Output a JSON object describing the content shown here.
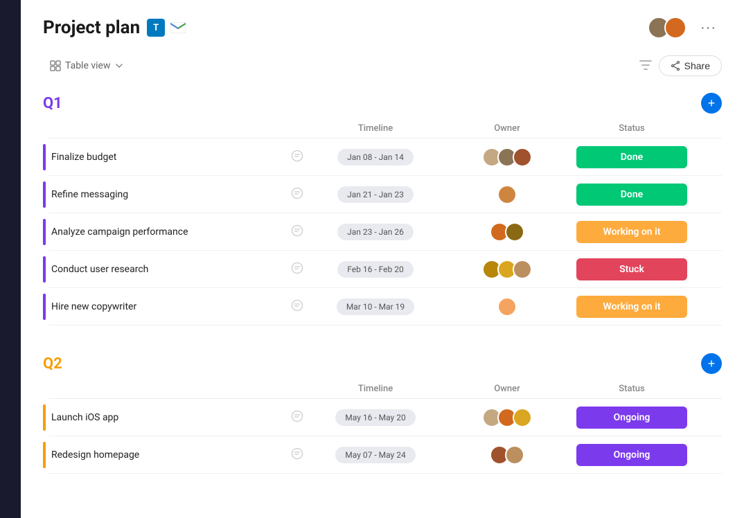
{
  "page": {
    "title": "Project plan"
  },
  "header": {
    "title": "Project plan",
    "trello_icon": "T",
    "gmail_icon": "M",
    "more_label": "···",
    "share_label": "Share",
    "view_label": "Table view"
  },
  "q1": {
    "title": "Q1",
    "timeline_col": "Timeline",
    "owner_col": "Owner",
    "status_col": "Status",
    "tasks": [
      {
        "name": "Finalize budget",
        "timeline": "Jan 08 - Jan 14",
        "status": "Done",
        "status_class": "status-done",
        "owners": [
          "av1",
          "av2",
          "av3"
        ]
      },
      {
        "name": "Refine messaging",
        "timeline": "Jan 21 - Jan 23",
        "status": "Done",
        "status_class": "status-done",
        "owners": [
          "av4"
        ]
      },
      {
        "name": "Analyze campaign performance",
        "timeline": "Jan 23 - Jan 26",
        "status": "Working on it",
        "status_class": "status-working",
        "owners": [
          "av5",
          "av6"
        ]
      },
      {
        "name": "Conduct user research",
        "timeline": "Feb 16 - Feb 20",
        "status": "Stuck",
        "status_class": "status-stuck",
        "owners": [
          "av7",
          "av8",
          "av9"
        ]
      },
      {
        "name": "Hire new copywriter",
        "timeline": "Mar 10 - Mar 19",
        "status": "Working on it",
        "status_class": "status-working",
        "owners": [
          "av10"
        ]
      }
    ]
  },
  "q2": {
    "title": "Q2",
    "timeline_col": "Timeline",
    "owner_col": "Owner",
    "status_col": "Status",
    "tasks": [
      {
        "name": "Launch iOS app",
        "timeline": "May 16 - May 20",
        "status": "Ongoing",
        "status_class": "status-ongoing",
        "owners": [
          "av1",
          "av5",
          "av8"
        ]
      },
      {
        "name": "Redesign homepage",
        "timeline": "May 07 - May 24",
        "status": "Ongoing",
        "status_class": "status-ongoing",
        "owners": [
          "av3",
          "av9"
        ]
      }
    ]
  }
}
